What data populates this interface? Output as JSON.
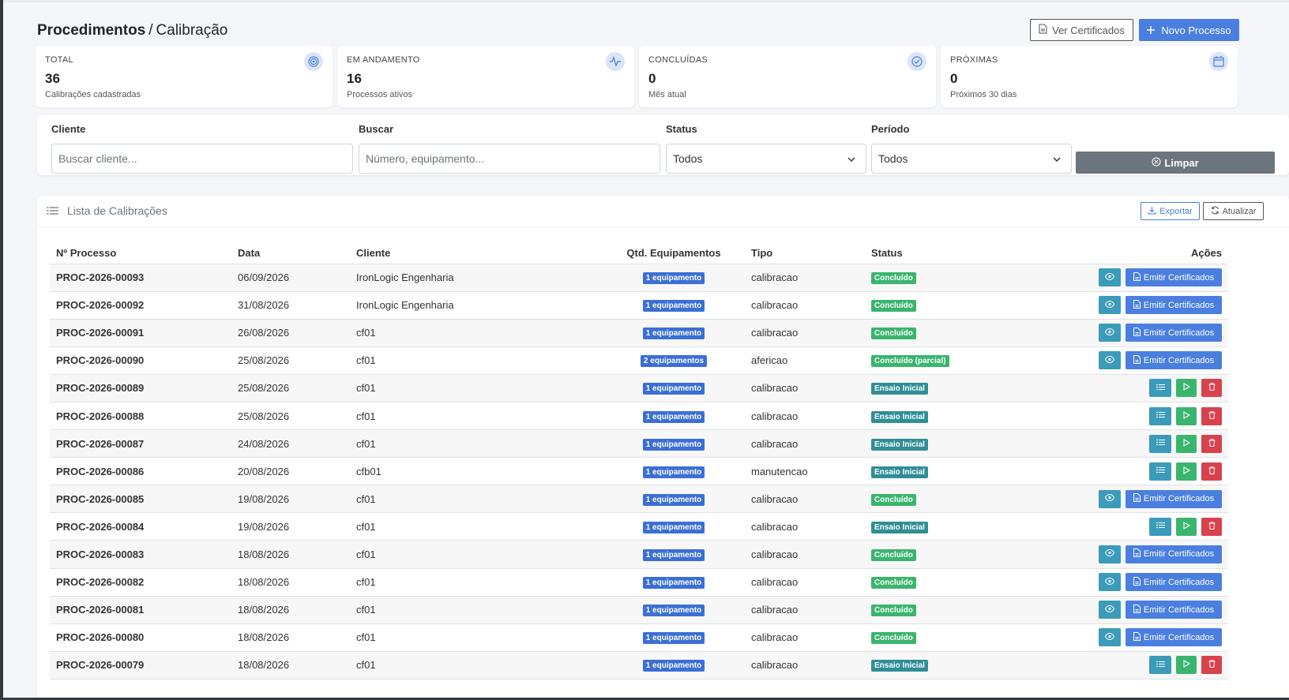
{
  "header": {
    "breadcrumb_main": "Procedimentos",
    "breadcrumb_separator": "/",
    "breadcrumb_current": "Calibração",
    "ver_certificados_label": "Ver Certificados",
    "novo_processo_label": "Novo Processo"
  },
  "stats": [
    {
      "label": "TOTAL",
      "value": "36",
      "sub": "Calibrações cadastradas",
      "icon": "target-icon"
    },
    {
      "label": "EM ANDAMENTO",
      "value": "16",
      "sub": "Processos ativos",
      "icon": "activity-icon"
    },
    {
      "label": "CONCLUÍDAS",
      "value": "0",
      "sub": "Mês atual",
      "icon": "check-circle-icon"
    },
    {
      "label": "PRÓXIMAS",
      "value": "0",
      "sub": "Próximos 30 dias",
      "icon": "calendar-icon"
    }
  ],
  "filters": {
    "cliente_label": "Cliente",
    "cliente_placeholder": "Buscar cliente...",
    "buscar_label": "Buscar",
    "buscar_placeholder": "Número, equipamento...",
    "status_label": "Status",
    "status_value": "Todos",
    "periodo_label": "Período",
    "periodo_value": "Todos",
    "limpar_label": "Limpar"
  },
  "list": {
    "title": "Lista de Calibrações",
    "exportar_label": "Exportar",
    "atualizar_label": "Atualizar",
    "columns": {
      "processo": "Nº Processo",
      "data": "Data",
      "cliente": "Cliente",
      "qtd": "Qtd. Equipamentos",
      "tipo": "Tipo",
      "status": "Status",
      "acoes": "Ações"
    },
    "emitir_label": "Emitir Certificados",
    "rows": [
      {
        "processo": "PROC-2026-00093",
        "data": "06/09/2026",
        "cliente": "IronLogic Engenharia",
        "qtd": "1 equipamento",
        "tipo": "calibracao",
        "status": "Concluído",
        "kind": "done"
      },
      {
        "processo": "PROC-2026-00092",
        "data": "31/08/2026",
        "cliente": "IronLogic Engenharia",
        "qtd": "1 equipamento",
        "tipo": "calibracao",
        "status": "Concluído",
        "kind": "done"
      },
      {
        "processo": "PROC-2026-00091",
        "data": "26/08/2026",
        "cliente": "cf01",
        "qtd": "1 equipamento",
        "tipo": "calibracao",
        "status": "Concluído",
        "kind": "done"
      },
      {
        "processo": "PROC-2026-00090",
        "data": "25/08/2026",
        "cliente": "cf01",
        "qtd": "2 equipamentos",
        "tipo": "afericao",
        "status": "Concluído (parcial)",
        "kind": "done"
      },
      {
        "processo": "PROC-2026-00089",
        "data": "25/08/2026",
        "cliente": "cf01",
        "qtd": "1 equipamento",
        "tipo": "calibracao",
        "status": "Ensaio Inicial",
        "kind": "pending"
      },
      {
        "processo": "PROC-2026-00088",
        "data": "25/08/2026",
        "cliente": "cf01",
        "qtd": "1 equipamento",
        "tipo": "calibracao",
        "status": "Ensaio Inicial",
        "kind": "pending"
      },
      {
        "processo": "PROC-2026-00087",
        "data": "24/08/2026",
        "cliente": "cf01",
        "qtd": "1 equipamento",
        "tipo": "calibracao",
        "status": "Ensaio Inicial",
        "kind": "pending"
      },
      {
        "processo": "PROC-2026-00086",
        "data": "20/08/2026",
        "cliente": "cfb01",
        "qtd": "1 equipamento",
        "tipo": "manutencao",
        "status": "Ensaio Inicial",
        "kind": "pending"
      },
      {
        "processo": "PROC-2026-00085",
        "data": "19/08/2026",
        "cliente": "cf01",
        "qtd": "1 equipamento",
        "tipo": "calibracao",
        "status": "Concluído",
        "kind": "done"
      },
      {
        "processo": "PROC-2026-00084",
        "data": "19/08/2026",
        "cliente": "cf01",
        "qtd": "1 equipamento",
        "tipo": "calibracao",
        "status": "Ensaio Inicial",
        "kind": "pending"
      },
      {
        "processo": "PROC-2026-00083",
        "data": "18/08/2026",
        "cliente": "cf01",
        "qtd": "1 equipamento",
        "tipo": "calibracao",
        "status": "Concluído",
        "kind": "done"
      },
      {
        "processo": "PROC-2026-00082",
        "data": "18/08/2026",
        "cliente": "cf01",
        "qtd": "1 equipamento",
        "tipo": "calibracao",
        "status": "Concluído",
        "kind": "done"
      },
      {
        "processo": "PROC-2026-00081",
        "data": "18/08/2026",
        "cliente": "cf01",
        "qtd": "1 equipamento",
        "tipo": "calibracao",
        "status": "Concluído",
        "kind": "done"
      },
      {
        "processo": "PROC-2026-00080",
        "data": "18/08/2026",
        "cliente": "cf01",
        "qtd": "1 equipamento",
        "tipo": "calibracao",
        "status": "Concluído",
        "kind": "done"
      },
      {
        "processo": "PROC-2026-00079",
        "data": "18/08/2026",
        "cliente": "cf01",
        "qtd": "1 equipamento",
        "tipo": "calibracao",
        "status": "Ensaio Inicial",
        "kind": "pending"
      }
    ]
  },
  "colors": {
    "primary": "#4a7fe0",
    "success": "#3ab56d",
    "info": "#3b9bba",
    "danger": "#d9414c",
    "secondary": "#6c757d",
    "status_pending": "#2f8e96"
  }
}
